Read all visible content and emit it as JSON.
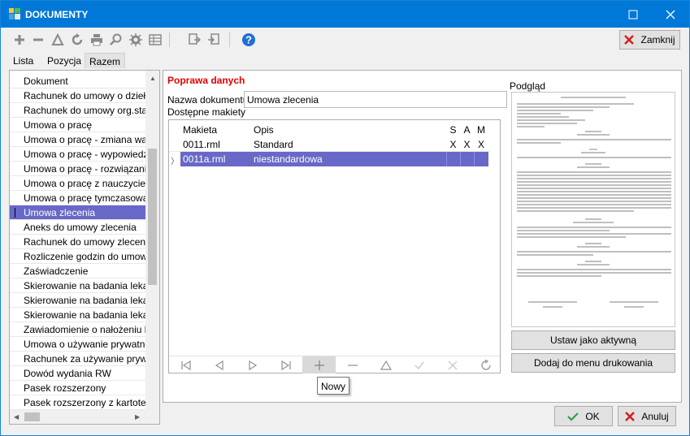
{
  "window": {
    "title": "DOKUMENTY"
  },
  "toolbar": {
    "icons": [
      "add-icon",
      "remove-icon",
      "edit-icon",
      "refresh-icon",
      "print-icon",
      "preview-icon",
      "settings-icon",
      "columns-icon",
      "export-icon",
      "import-icon",
      "help-icon"
    ],
    "close_label": "Zamknij"
  },
  "tabs": [
    "Lista",
    "Pozycja",
    "Razem"
  ],
  "active_tab": "Razem",
  "document_list": {
    "header": "Dokument",
    "items": [
      "Rachunek do umowy o dzieło",
      "Rachunek do umowy org.stano",
      "Umowa o pracę",
      "Umowa o pracę - zmiana warun",
      "Umowa o pracę - wypowiedzen",
      "Umowa o pracę - rozwiązanie",
      "Umowa o pracę z nauczycielem",
      "Umowa o pracę tymczasową",
      "Umowa zlecenia",
      "Aneks do umowy zlecenia",
      "Rachunek do umowy zlecenia",
      "Rozliczenie godzin do umowy zl",
      "Zaświadczenie",
      "Skierowanie na badania lekarsk",
      "Skierowanie na badania lekarsk",
      "Skierowanie na badania lekarsk",
      "Zawiadomienie o nałożeniu kary",
      "Umowa o używanie prywatnego",
      "Rachunek za używanie prywatn",
      "Dowód wydania RW",
      "Pasek rozszerzony",
      "Pasek rozszerzony z kartoteki"
    ],
    "selected": "Umowa zlecenia"
  },
  "edit": {
    "section_title": "Poprawa danych",
    "name_label": "Nazwa dokumentu",
    "name_value": "Umowa zlecenia",
    "templates_label": "Dostępne makiety",
    "preview_label": "Podgląd"
  },
  "templates": {
    "columns": [
      "Makieta",
      "Opis",
      "S",
      "A",
      "M"
    ],
    "rows": [
      {
        "makieta": "0011.rml",
        "opis": "Standard",
        "s": "X",
        "a": "X",
        "m": "X"
      },
      {
        "makieta": "0011a.rml",
        "opis": "niestandardowa",
        "s": "",
        "a": "",
        "m": ""
      }
    ],
    "selected_row": 1
  },
  "navigator": [
    "first-icon",
    "prior-icon",
    "next-icon",
    "last-icon",
    "insert-icon",
    "delete-icon",
    "edit-icon",
    "post-icon",
    "cancel-icon",
    "refresh-icon"
  ],
  "tooltip": "Nowy",
  "buttons": {
    "set_active": "Ustaw jako aktywną",
    "add_print_menu": "Dodaj do menu drukowania",
    "ok": "OK",
    "cancel": "Anuluj"
  },
  "colors": {
    "titlebar": "#0078d7",
    "selection": "#6868c8",
    "section_title": "#e00000",
    "ok_icon": "#2e9e48",
    "cancel_icon": "#d42020",
    "help_icon": "#1f6fcf"
  }
}
